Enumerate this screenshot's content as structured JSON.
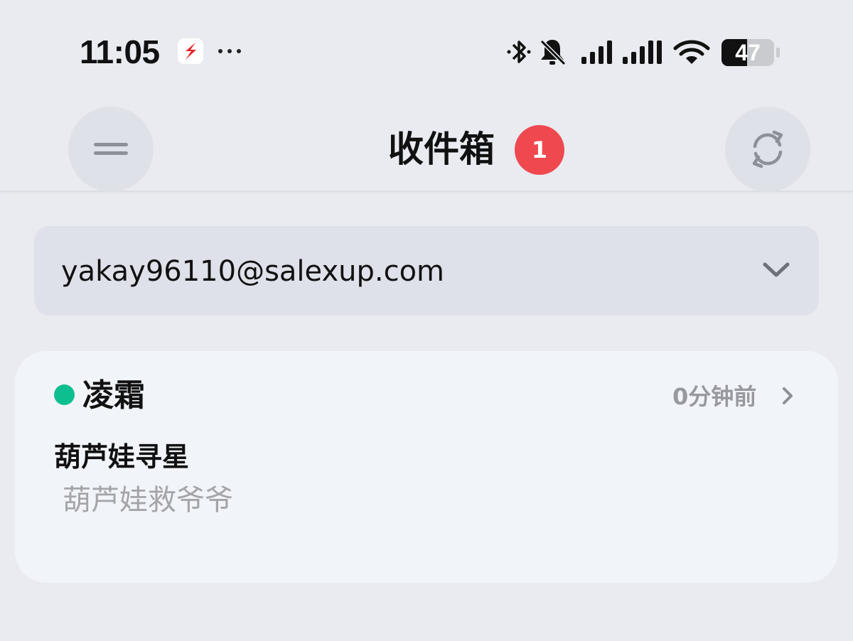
{
  "status_bar": {
    "time": "11:05",
    "battery_level": "47",
    "icons": [
      "app-s-icon",
      "more-dots-icon",
      "bluetooth-icon",
      "bell-muted-icon",
      "signal-icon",
      "signal-icon-2",
      "wifi-icon",
      "battery-icon"
    ]
  },
  "header": {
    "title": "收件箱",
    "unread_count": "1",
    "menu_icon": "menu-icon",
    "refresh_icon": "refresh-icon"
  },
  "account": {
    "email": "yakay96110@salexup.com"
  },
  "messages": [
    {
      "sender": "凌霜",
      "time_ago": "0分钟前",
      "subject": "葫芦娃寻星",
      "preview": "葫芦娃救爷爷",
      "status_color": "#0dbf8e"
    }
  ],
  "colors": {
    "background": "#e9ebf0",
    "badge": "#f0484f",
    "online": "#0dbf8e",
    "card": "#f1f4f8"
  }
}
